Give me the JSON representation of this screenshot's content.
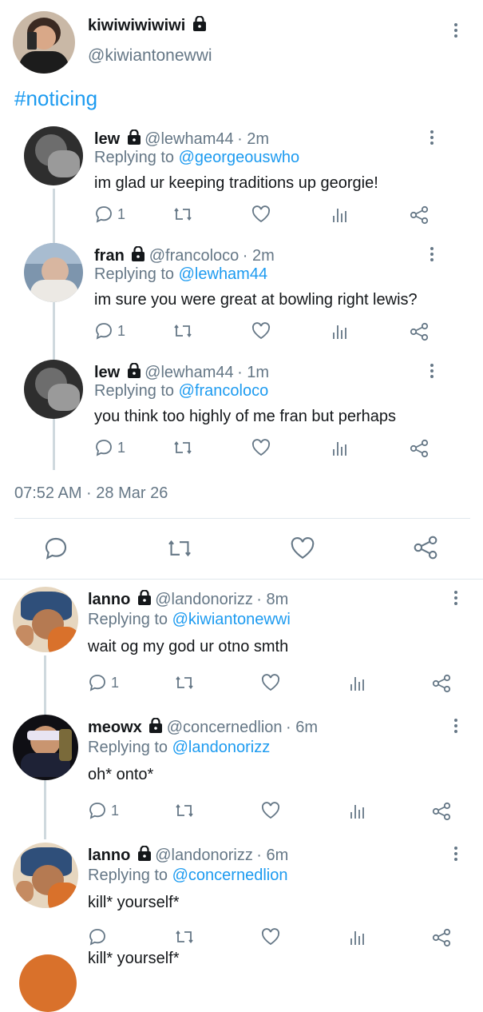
{
  "main_tweet": {
    "name": "kiwiwiwiwiwi",
    "handle": "@kiwiantonewwi",
    "text": "#noticing",
    "timestamp": "07:52 AM · 28 Mar 26"
  },
  "nested_replies": [
    {
      "name": "lew",
      "handle": "@lewham44",
      "time": "· 2m",
      "replying_prefix": "Replying to",
      "replying_to": "@georgeouswho",
      "text": "im glad ur keeping traditions up georgie!",
      "reply_count": "1"
    },
    {
      "name": "fran",
      "handle": "@francoloco",
      "time": "· 2m",
      "replying_prefix": "Replying to",
      "replying_to": "@lewham44",
      "text": "im sure you were great at bowling right lewis?",
      "reply_count": "1"
    },
    {
      "name": "lew",
      "handle": "@lewham44",
      "time": "· 1m",
      "replying_prefix": "Replying to",
      "replying_to": "@francoloco",
      "text": "you think too highly of me fran but perhaps",
      "reply_count": "1"
    }
  ],
  "replies": [
    {
      "name": "lanno",
      "handle": "@landonorizz",
      "time": "· 8m",
      "replying_prefix": "Replying to",
      "replying_to": "@kiwiantonewwi",
      "text": "wait og my god ur otno smth",
      "reply_count": "1"
    },
    {
      "name": "meowx",
      "handle": "@concernedlion",
      "time": "· 6m",
      "replying_prefix": "Replying to",
      "replying_to": "@landonorizz",
      "text": "oh* onto*",
      "reply_count": "1"
    },
    {
      "name": "lanno",
      "handle": "@landonorizz",
      "time": "· 6m",
      "replying_prefix": "Replying to",
      "replying_to": "@concernedlion",
      "text": "kill* yourself*",
      "reply_count": ""
    }
  ],
  "partial_text": "kill* yourself*",
  "icons": {
    "reply": "speech-bubble-icon",
    "retweet": "retweet-icon",
    "like": "heart-icon",
    "views": "bar-chart-icon",
    "share": "share-icon",
    "lock": "lock-icon",
    "more": "more-vertical-icon"
  },
  "colors": {
    "link": "#1d9bf0",
    "muted": "#657786",
    "text": "#14171a",
    "divider": "#e1e8ed"
  }
}
